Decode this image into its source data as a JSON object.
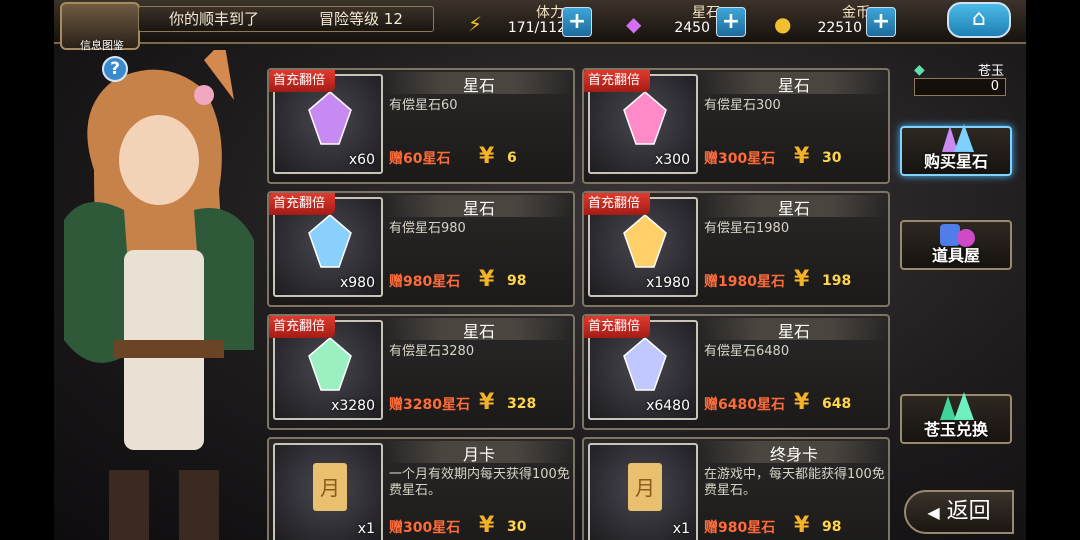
{
  "header": {
    "player_name": "你的顺丰到了",
    "level_label": "冒险等级",
    "level": "12",
    "profile_label": "信息图鉴",
    "help": "?"
  },
  "resources": {
    "stamina": {
      "label": "体力",
      "value": "171/112",
      "icon": "lightning-icon"
    },
    "stones": {
      "label": "星石",
      "value": "2450",
      "icon": "crystal-icon"
    },
    "gold": {
      "label": "金币",
      "value": "22510",
      "icon": "coin-icon"
    }
  },
  "plus_symbol": "+",
  "home_icon": "⌂",
  "jade": {
    "label": "苍玉",
    "value": "0"
  },
  "side": {
    "buy_stones": "购买星石",
    "item_shop": "道具屋",
    "jade_exchange": "苍玉兑换"
  },
  "back": {
    "arrow": "◀",
    "label": "返回"
  },
  "cards": [
    {
      "badge": "首充翻倍",
      "title": "星石",
      "desc": "有偿星石60",
      "qty": "x60",
      "bonus": "赠60星石",
      "price": "6"
    },
    {
      "badge": "首充翻倍",
      "title": "星石",
      "desc": "有偿星石300",
      "qty": "x300",
      "bonus": "赠300星石",
      "price": "30"
    },
    {
      "badge": "首充翻倍",
      "title": "星石",
      "desc": "有偿星石980",
      "qty": "x980",
      "bonus": "赠980星石",
      "price": "98"
    },
    {
      "badge": "首充翻倍",
      "title": "星石",
      "desc": "有偿星石1980",
      "qty": "x1980",
      "bonus": "赠1980星石",
      "price": "198"
    },
    {
      "badge": "首充翻倍",
      "title": "星石",
      "desc": "有偿星石3280",
      "qty": "x3280",
      "bonus": "赠3280星石",
      "price": "328"
    },
    {
      "badge": "首充翻倍",
      "title": "星石",
      "desc": "有偿星石6480",
      "qty": "x6480",
      "bonus": "赠6480星石",
      "price": "648"
    },
    {
      "badge": "",
      "title": "月卡",
      "desc": "一个月有效期内每天获得100免费星石。",
      "qty": "x1",
      "bonus": "赠300星石",
      "price": "30"
    },
    {
      "badge": "",
      "title": "终身卡",
      "desc": "在游戏中，每天都能获得100免费星石。",
      "qty": "x1",
      "bonus": "赠980星石",
      "price": "98"
    }
  ],
  "currency_symbol": "¥"
}
